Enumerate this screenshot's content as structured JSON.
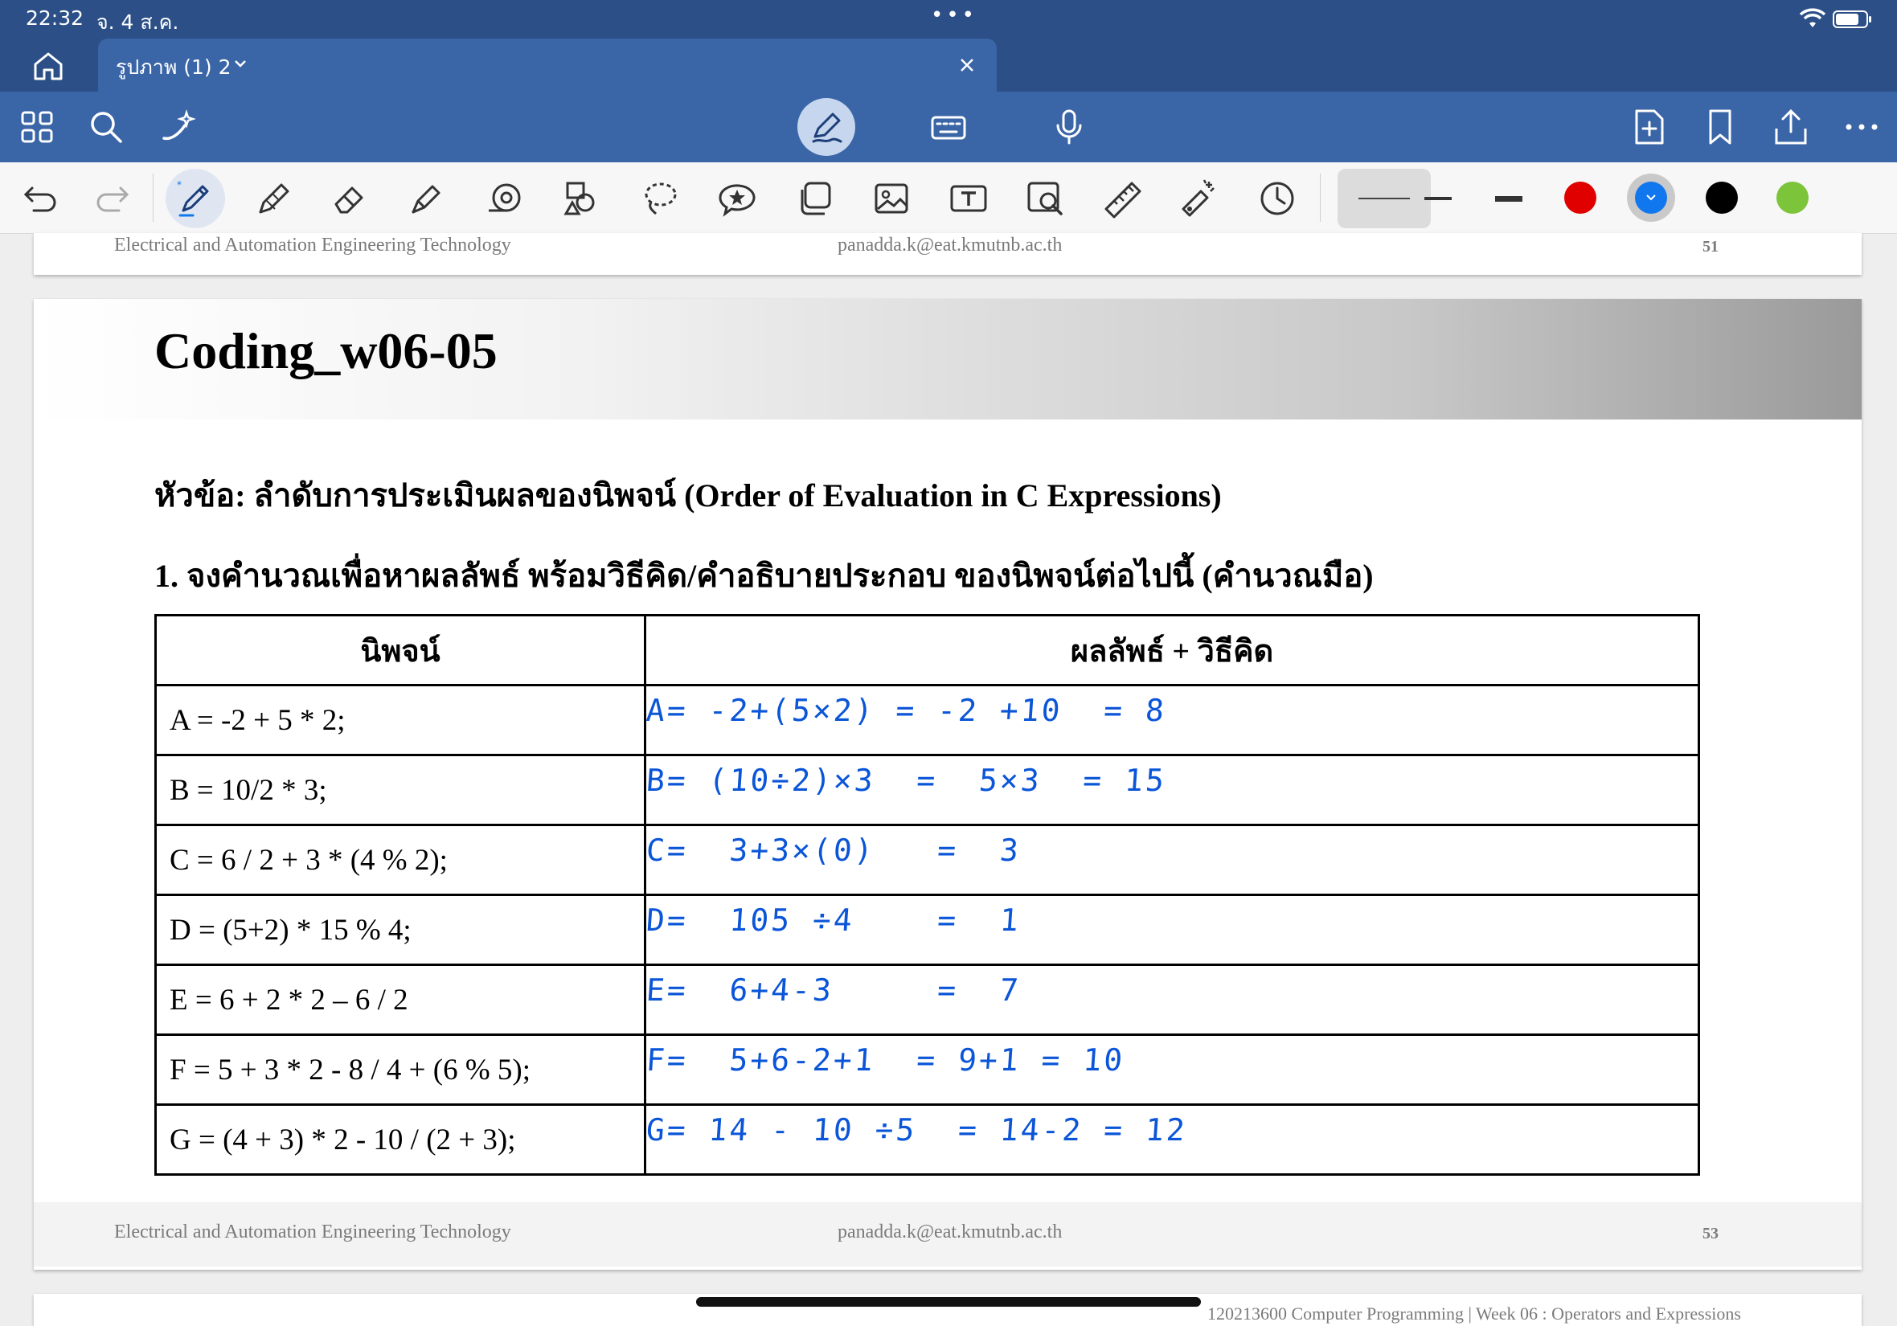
{
  "status_bar": {
    "time": "22:32",
    "date": "จ. 4 ส.ค.",
    "dots": "•••"
  },
  "tab": {
    "title": "รูปภาพ (1) 2"
  },
  "toolbar_icons": [
    "apps-grid-icon",
    "search-icon",
    "sparkle-pen-icon",
    "pen-mode-icon",
    "keyboard-icon",
    "microphone-icon",
    "add-page-icon",
    "bookmark-icon",
    "share-icon",
    "more-icon"
  ],
  "drawing_tools": [
    "undo-icon",
    "redo-icon",
    "ballpoint-pen-icon",
    "pencil-icon",
    "eraser-icon",
    "highlighter-icon",
    "tape-icon",
    "shapes-icon",
    "lasso-icon",
    "sticker-icon",
    "element-icon",
    "image-icon",
    "text-box-icon",
    "magnifier-icon",
    "ruler-icon",
    "laser-pointer-icon",
    "history-icon"
  ],
  "pen_colors": [
    "#e00000",
    "#1177ee",
    "#000000",
    "#7cc43a"
  ],
  "selected_color": "#1177ee",
  "page_prev_footer": {
    "left": "Electrical and Automation Engineering Technology",
    "center": "panadda.k@eat.kmutnb.ac.th",
    "page": "51"
  },
  "slide": {
    "title": "Coding_w06-05",
    "topic": "หัวข้อ: ลำดับการประเมินผลของนิพจน์ (Order of Evaluation in C Expressions)",
    "question": "1. จงคำนวณเพื่อหาผลลัพธ์ พร้อมวิธีคิด/คำอธิบายประกอบ ของนิพจน์ต่อไปนี้ (คำนวณมือ)",
    "table": {
      "headers": [
        "นิพจน์",
        "ผลลัพธ์ + วิธีคิด"
      ],
      "rows": [
        {
          "expr": "A = -2 + 5 * 2;",
          "answer": "A= -2+(5×2) = -2 +10  = 8"
        },
        {
          "expr": "B = 10/2 * 3;",
          "answer": "B= (10÷2)×3  =  5×3  = 15"
        },
        {
          "expr": "C = 6 / 2 + 3 * (4 % 2);",
          "answer": "C=  3+3×(0)   =  3"
        },
        {
          "expr": "D = (5+2) * 15 % 4;",
          "answer": "D=  105 ÷4    =  1"
        },
        {
          "expr": "E = 6 + 2 * 2 – 6 / 2",
          "answer": "E=  6+4-3     =  7"
        },
        {
          "expr": "F = 5 + 3 * 2 - 8 / 4 + (6 % 5);",
          "answer": "F=  5+6-2+1  = 9+1 = 10"
        },
        {
          "expr": "G = (4 + 3) * 2 - 10 / (2 + 3);",
          "answer": "G= 14 - 10 ÷5  = 14-2 = 12"
        }
      ]
    },
    "footer": {
      "left": "Electrical and Automation Engineering Technology",
      "center": "panadda.k@eat.kmutnb.ac.th",
      "page": "53"
    }
  },
  "next_page_header": "120213600 Computer Programming | Week 06 : Operators and Expressions"
}
